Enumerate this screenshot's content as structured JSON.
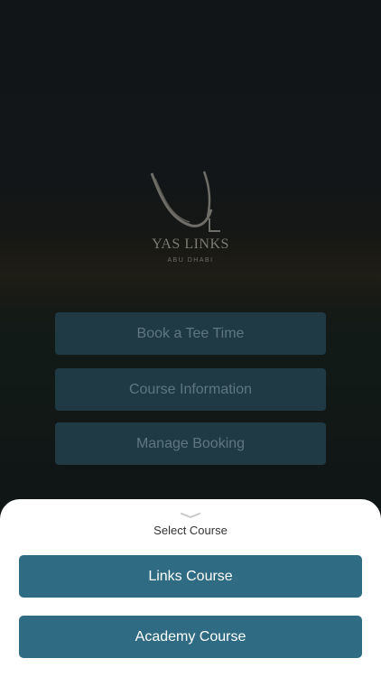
{
  "brand": {
    "name": "YAS LINKS",
    "subtitle": "ABU DHABI"
  },
  "menu": {
    "book_tee_time": "Book a Tee Time",
    "course_information": "Course Information",
    "manage_booking": "Manage Booking"
  },
  "sheet": {
    "title": "Select Course",
    "options": [
      "Links Course",
      "Academy Course"
    ]
  },
  "colors": {
    "menu_button_bg": "#1f3a45",
    "course_button_bg": "#2f6b82",
    "sheet_bg": "#ffffff"
  },
  "icons": {
    "logo": "yas-links-logo-icon",
    "handle": "chevron-down-icon"
  }
}
